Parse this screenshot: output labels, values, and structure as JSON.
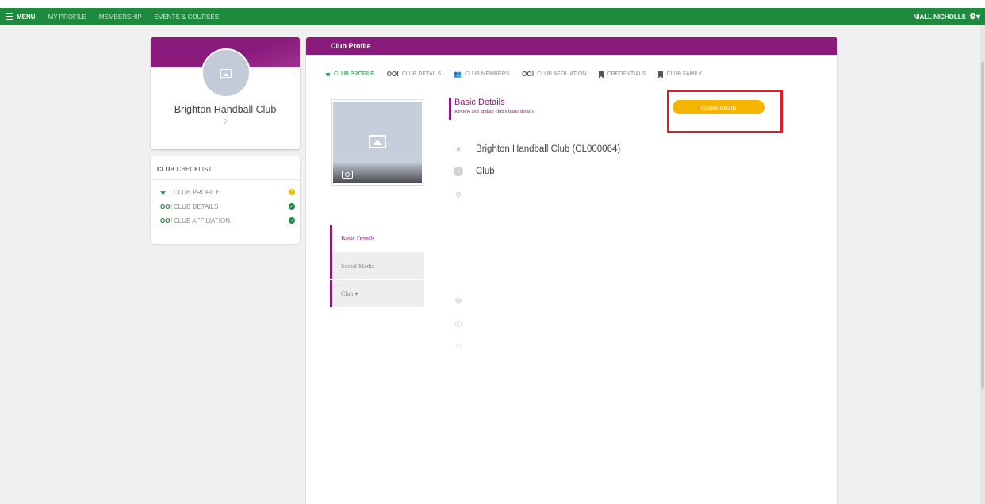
{
  "navbar": {
    "menu_label": "MENU",
    "links": [
      "MY PROFILE",
      "MEMBERSHIP",
      "EVENTS & COURSES"
    ],
    "user_name": "NIALL NICHOLLS"
  },
  "profile_card": {
    "club_name": "Brighton Handball Club"
  },
  "checklist": {
    "title_bold": "CLUB",
    "title_rest": " CHECKLIST",
    "items": [
      {
        "icon": "★",
        "label": "CLUB PROFILE",
        "status": "pending"
      },
      {
        "icon": "oo!",
        "label": "CLUB DETAILS",
        "status": "complete"
      },
      {
        "icon": "oo!",
        "label": "CLUB AFFILIATION",
        "status": "complete"
      }
    ]
  },
  "panel": {
    "header": "Club Profile",
    "tabs": [
      {
        "icon": "★",
        "label": "CLUB PROFILE"
      },
      {
        "icon": "oo!",
        "label": "CLUB DETAILS"
      },
      {
        "icon": "👥",
        "label": "CLUB MEMBERS"
      },
      {
        "icon": "oo!",
        "label": "CLUB AFFILIATION"
      },
      {
        "icon": "bookmark",
        "label": "CREDENTIALS"
      },
      {
        "icon": "bookmark",
        "label": "CLUB FAMILY"
      }
    ],
    "side_nav": [
      "Basic Details",
      "Social Media",
      "Club ▾"
    ],
    "details": {
      "title": "Basic Details",
      "subtitle": "Review and update club's basic details",
      "update_button": "Update Details",
      "club_full_name": "Brighton Handball Club (CL000064)",
      "club_type": "Club"
    }
  },
  "colors": {
    "green": "#1e8a3e",
    "purple": "#8a1a7c",
    "yellow": "#f5b400",
    "highlight_red": "#e21c2a"
  }
}
